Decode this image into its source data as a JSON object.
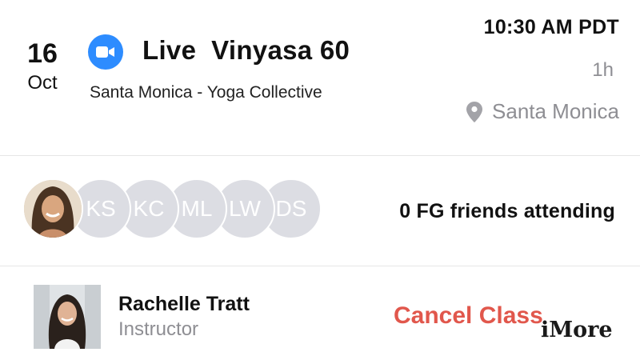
{
  "class": {
    "day": "16",
    "month": "Oct",
    "title": "Live  Vinyasa 60",
    "venue": "Santa Monica - Yoga Collective",
    "time": "10:30 AM PDT",
    "duration": "1h",
    "location": "Santa Monica",
    "video_icon": "zoom-video-icon",
    "location_icon": "location-pin-icon"
  },
  "attendees": {
    "avatars": [
      {
        "type": "photo",
        "icon": "user-photo-avatar"
      },
      {
        "type": "initials",
        "initials": "KS"
      },
      {
        "type": "initials",
        "initials": "KC"
      },
      {
        "type": "initials",
        "initials": "ML"
      },
      {
        "type": "initials",
        "initials": "LW"
      },
      {
        "type": "initials",
        "initials": "DS"
      }
    ],
    "friends_text": "0 FG friends attending"
  },
  "instructor": {
    "name": "Rachelle Tratt",
    "role": "Instructor",
    "photo_icon": "instructor-photo"
  },
  "actions": {
    "cancel_label": "Cancel Class"
  },
  "watermark": "iMore",
  "colors": {
    "accent_blue": "#2d8cff",
    "cancel_red": "#e1574c",
    "muted_gray": "#8e8e93",
    "avatar_gray": "#dcdde3"
  }
}
